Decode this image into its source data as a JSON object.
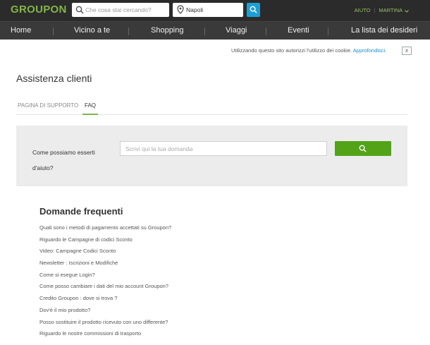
{
  "header": {
    "logo": "GROUPON",
    "search_placeholder": "Che cosa stai cercando?",
    "location_value": "Napoli",
    "help_link": "AIUTO",
    "user_name": "MARTINA"
  },
  "nav": {
    "items": [
      {
        "label": "Home"
      },
      {
        "label": "Vicino a te"
      },
      {
        "label": "Shopping"
      },
      {
        "label": "Viaggi"
      },
      {
        "label": "Eventi"
      },
      {
        "label": "La lista dei desideri"
      }
    ]
  },
  "cookie": {
    "text": "Utilizzando questo sito autorizzi l'utilizzo dei cookie.",
    "link": "Approfondisci.",
    "close": "x"
  },
  "page": {
    "title": "Assistenza clienti",
    "tabs": [
      {
        "label": "PAGINA DI SUPPORTO",
        "active": false
      },
      {
        "label": "FAQ",
        "active": true
      }
    ]
  },
  "question": {
    "label_line1": "Come possiamo esserti",
    "label_line2": "d'aiuto?",
    "placeholder": "Scrivi qui la tua domanda"
  },
  "faq": {
    "title": "Domande frequenti",
    "items": [
      "Quali sono i metodi di pagamento accettati su Groupon?",
      "Riguardo le Campagne di codici Sconto",
      "Video: Campagne Codici Sconto",
      "Newsletter : Iscrizioni e Modifiche",
      "Come si esegue Login?",
      "Come posso cambiare i dati del mio account Groupon?",
      "Credito Groupon : dove si trova ?",
      "Dov'è il mio prodotto?",
      "Posso sostituire il prodotto ricevuto con uno differente?",
      "Riguardo le nostre commissioni di trasporto"
    ]
  },
  "colors": {
    "brand_green": "#82b548",
    "button_green": "#53a318",
    "search_blue": "#1ba0d6",
    "header_bg": "#2b2b2b",
    "nav_bg": "#3a3a3a",
    "panel_bg": "#ececec"
  }
}
